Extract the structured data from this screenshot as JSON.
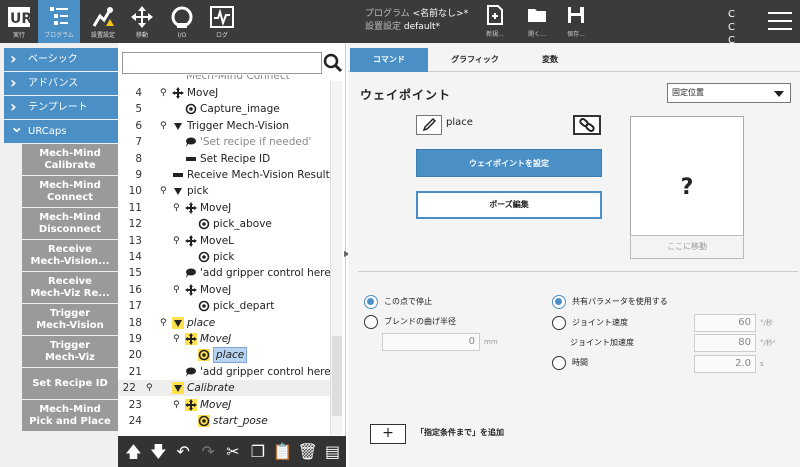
{
  "topbar": {
    "buttons": [
      {
        "label": "実行",
        "icon": "ur-logo-icon"
      },
      {
        "label": "プログラム",
        "icon": "program-icon",
        "active": true
      },
      {
        "label": "設置設定",
        "icon": "installation-icon"
      },
      {
        "label": "移動",
        "icon": "move-icon"
      },
      {
        "label": "I/O",
        "icon": "io-icon"
      },
      {
        "label": "ログ",
        "icon": "log-icon"
      }
    ],
    "program_label": "プログラム",
    "program_value": "<名前なし>*",
    "install_label": "設置設定",
    "install_value": "default*",
    "file_buttons": [
      "新規...",
      "開く...",
      "保存..."
    ],
    "cc_text": [
      "C C",
      "C C"
    ]
  },
  "sidebar": {
    "sections": [
      {
        "label": "ベーシック",
        "open": false
      },
      {
        "label": "アドバンス",
        "open": false
      },
      {
        "label": "テンプレート",
        "open": false
      },
      {
        "label": "URCaps",
        "open": true
      }
    ],
    "urcaps_items": [
      [
        "Mech-Mind",
        "Calibrate"
      ],
      [
        "Mech-Mind",
        "Connect"
      ],
      [
        "Mech-Mind",
        "Disconnect"
      ],
      [
        "Receive",
        "Mech-Vision..."
      ],
      [
        "Receive",
        "Mech-Viz Re..."
      ],
      [
        "Trigger",
        "Mech-Vision"
      ],
      [
        "Trigger",
        "Mech-Viz"
      ],
      [
        "Set Recipe ID"
      ],
      [
        "Mech-Mind",
        "Pick and Place"
      ]
    ]
  },
  "tree": {
    "search_placeholder": "",
    "partial_top_row": "Mech-Mind Connect",
    "rows": [
      {
        "n": "4",
        "text": "MoveJ",
        "icon": "move-icon",
        "indent": 0,
        "pin": true
      },
      {
        "n": "5",
        "text": "Capture_image",
        "icon": "waypoint-icon",
        "indent": 1
      },
      {
        "n": "6",
        "text": "Trigger Mech-Vision",
        "icon": "folder-icon",
        "indent": 0,
        "pin": true
      },
      {
        "n": "7",
        "text": "'Set recipe if needed'",
        "icon": "comment-icon",
        "indent": 1,
        "gray": true
      },
      {
        "n": "8",
        "text": "Set Recipe ID",
        "icon": "set-icon",
        "indent": 1
      },
      {
        "n": "9",
        "text": "Receive Mech-Vision Result",
        "icon": "set-icon",
        "indent": 0
      },
      {
        "n": "10",
        "text": "pick",
        "icon": "folder-icon",
        "indent": 0,
        "pin": true
      },
      {
        "n": "11",
        "text": "MoveJ",
        "icon": "move-icon",
        "indent": 1,
        "pin": true
      },
      {
        "n": "12",
        "text": "pick_above",
        "icon": "waypoint-icon",
        "indent": 2
      },
      {
        "n": "13",
        "text": "MoveL",
        "icon": "move-icon",
        "indent": 1,
        "pin": true
      },
      {
        "n": "14",
        "text": "pick",
        "icon": "waypoint-icon",
        "indent": 2
      },
      {
        "n": "15",
        "text": "'add gripper control here'",
        "icon": "comment-icon",
        "indent": 1
      },
      {
        "n": "16",
        "text": "MoveJ",
        "icon": "move-icon",
        "indent": 1,
        "pin": true
      },
      {
        "n": "17",
        "text": "pick_depart",
        "icon": "waypoint-icon",
        "indent": 2
      },
      {
        "n": "18",
        "text": "place",
        "icon": "folder-icon-yellow",
        "indent": 0,
        "pin": true,
        "italic": true
      },
      {
        "n": "19",
        "text": "MoveJ",
        "icon": "move-icon-yellow",
        "indent": 1,
        "pin": true,
        "italic": true
      },
      {
        "n": "20",
        "text": "place",
        "icon": "waypoint-icon-yellow",
        "indent": 2,
        "italic": true,
        "selected": true
      },
      {
        "n": "21",
        "text": "'add gripper control here'",
        "icon": "comment-icon",
        "indent": 1
      },
      {
        "n": "22",
        "text": "Calibrate",
        "icon": "folder-icon-yellow",
        "indent": 0,
        "pin": true,
        "italic": true,
        "outdent": true
      },
      {
        "n": "23",
        "text": "MoveJ",
        "icon": "move-icon-yellow",
        "indent": 1,
        "pin": true,
        "italic": true
      },
      {
        "n": "24",
        "text": "start_pose",
        "icon": "waypoint-icon-yellow",
        "indent": 2,
        "italic": true
      }
    ]
  },
  "right": {
    "tabs": [
      "コマンド",
      "グラフィック",
      "変数"
    ],
    "title": "ウェイポイント",
    "select_value": "固定位置",
    "waypoint_name": "place",
    "set_waypoint_label": "ウェイポイントを設定",
    "edit_pose_label": "ポーズ編集",
    "preview_text": "?",
    "move_here_label": "ここに移動",
    "stop_here_label": "この点で停止",
    "blend_label": "ブレンドの曲げ半径",
    "blend_value": "0",
    "blend_unit": "mm",
    "shared_params_label": "共有パラメータを使用する",
    "joint_speed_label": "ジョイント速度",
    "joint_speed_value": "60",
    "joint_speed_unit": "°/秒",
    "joint_accel_label": "ジョイント加速度",
    "joint_accel_value": "80",
    "joint_accel_unit": "°/秒²",
    "time_label": "時間",
    "time_value": "2.0",
    "time_unit": "s",
    "add_button": "+",
    "add_label": "「指定条件まで」を追加"
  },
  "colors": {
    "accent": "#4a90c7",
    "topbar": "#3b3b3b",
    "sidebar_item": "#9a9a9a",
    "highlight": "#ffe14d"
  }
}
